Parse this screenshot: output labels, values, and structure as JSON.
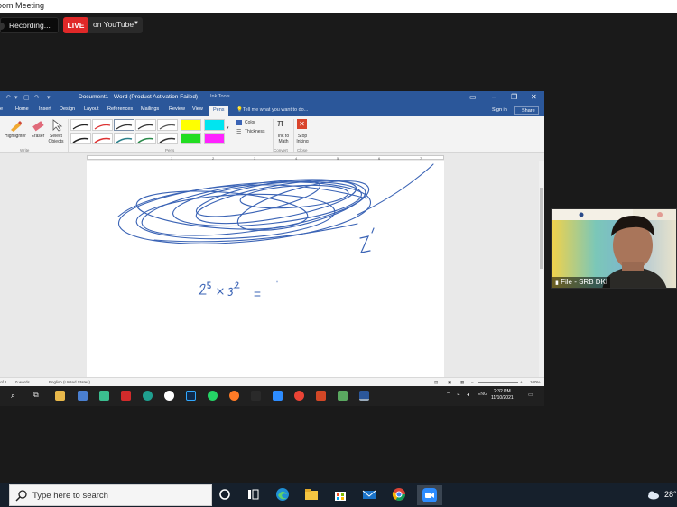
{
  "zoom": {
    "title": "oom Meeting",
    "recording_label": "Recording...",
    "live_badge": "LIVE",
    "live_target": "on YouTube"
  },
  "word": {
    "title": "Document1 - Word (Product Activation Failed)",
    "ink_tools": "Ink Tools",
    "tabs": [
      "e",
      "Home",
      "Insert",
      "Design",
      "Layout",
      "References",
      "Mailings",
      "Review",
      "View",
      "Pens"
    ],
    "active_tab": "Pens",
    "tell_me": "Tell me what you want to do...",
    "sign_in": "Sign in",
    "share": "Share",
    "ribbon": {
      "highlighter": "Highlighter",
      "eraser": "Eraser",
      "select_objects": "Select Objects",
      "color": "Color",
      "thickness": "Thickness",
      "ink_to_math": "Ink to Math",
      "stop_inking": "Stop Inking",
      "group_write": "Write",
      "group_pens": "Pens",
      "group_convert": "Convert",
      "group_close": "Close"
    },
    "ruler_numbers": [
      "1",
      "2",
      "3",
      "4",
      "5",
      "6",
      "7"
    ],
    "status": {
      "page": "of 1",
      "words": "0 words",
      "language": "English (United States)",
      "zoom": "100%"
    },
    "clock_time": "2:32 PM",
    "clock_date": "11/10/2021",
    "lang": "ENG"
  },
  "participant": {
    "name": "File - SRB DKI"
  },
  "taskbar": {
    "search_placeholder": "Type here to search",
    "temperature": "28°"
  },
  "colors": {
    "word_blue": "#2b579a",
    "ink_blue": "#3a63b5",
    "live_red": "#e02828",
    "zoom_bg": "#1a1a1a"
  }
}
